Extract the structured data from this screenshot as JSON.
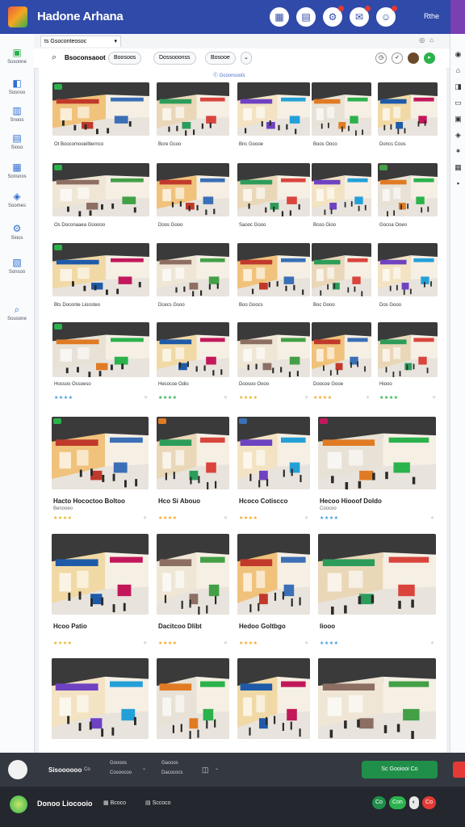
{
  "app": {
    "title": "Hadone Arhana",
    "top_right_label": "Rthe"
  },
  "top_icons": [
    {
      "name": "grid-icon",
      "glyph": "▦"
    },
    {
      "name": "store-icon",
      "glyph": "▤"
    },
    {
      "name": "settings-icon",
      "glyph": "⚙"
    },
    {
      "name": "bell-icon",
      "glyph": "✉"
    },
    {
      "name": "user-icon",
      "glyph": "☺"
    }
  ],
  "sidebar": {
    "items": [
      {
        "icon": "home-icon",
        "glyph": "▣",
        "label": "Sosonne"
      },
      {
        "icon": "person-icon",
        "glyph": "◧",
        "label": "Sosnoo"
      },
      {
        "icon": "chart-icon",
        "glyph": "▥",
        "label": "Snoos"
      },
      {
        "icon": "list-icon",
        "glyph": "▤",
        "label": "Sioso"
      },
      {
        "icon": "calendar-icon",
        "glyph": "▦",
        "label": "Sonsnos"
      },
      {
        "icon": "tag-icon",
        "glyph": "◈",
        "label": "Soomes"
      },
      {
        "icon": "gear-icon",
        "glyph": "⚙",
        "label": "Sioos"
      },
      {
        "icon": "folder-icon",
        "glyph": "▧",
        "label": "Sonsoo"
      },
      {
        "icon": "search-icon",
        "glyph": "⌕",
        "label": "Sousone"
      }
    ]
  },
  "tab": {
    "label": "ts  Gsoconteosoc"
  },
  "filter": {
    "search_label": "Bsoconsaoot",
    "chips": [
      "Boosoos",
      "Dossooonss",
      "Bosooe"
    ]
  },
  "content_hint": "Ⓒ Gcoonsoots",
  "grid_captions": [
    [
      "Ot Boocomooeilbernco",
      "Bcre Gcoo",
      "Bnc Goooe",
      "Boos Ooco",
      "Doncs Coos"
    ],
    [
      "Os Doconaaea Gooooo",
      "Doos Gooo",
      "Saooc Gooo",
      "Bcoo Gioo",
      "Gocoa Ooeo"
    ],
    [
      "Bts Doconte Lioosteo",
      "Dcecs Gsoo",
      "Boo Goocs",
      "Boc Gooo",
      "Dos Gooo"
    ]
  ],
  "row4_captions": [
    "Hossoo Ossoeso",
    "Hecocse Odio",
    "Doosoo Oooo",
    "Doocoe Gooe",
    "Hiooo"
  ],
  "large_rows": [
    {
      "titles": [
        "Hacto Hococtoo Boltoo",
        "Hco Si Abouo",
        "Hcoco Cotiscco",
        "Hecoo Hiooof Doldo"
      ],
      "subtitles": [
        "Benooeo",
        "",
        "",
        "Coocoo"
      ]
    },
    {
      "titles": [
        "Hcoo Patio",
        "Dacitcoo Dlibt",
        "Hedoo Goltbgo",
        "Iiooo"
      ],
      "subtitles": [
        "",
        "",
        "",
        ""
      ]
    },
    {
      "titles": [
        "",
        "",
        "",
        ""
      ],
      "subtitles": [
        "",
        "",
        "",
        ""
      ]
    }
  ],
  "player": {
    "title": "Sisoooooo",
    "meta1": "Co",
    "col1": [
      "Goooos",
      "Cosoocoo"
    ],
    "col2": [
      "Gacoos",
      "Dacococs"
    ],
    "action_label": "Sc Gooiooi Co"
  },
  "footer": {
    "title": "Donoo Liocooio",
    "items": [
      "Bcoco",
      "Sccoco"
    ],
    "actions": [
      "Co",
      "Con",
      "◐",
      "Co"
    ]
  },
  "colors": {
    "brand": "#2f4aa8",
    "accent_green": "#2bb24c",
    "accent_red": "#e53935"
  }
}
